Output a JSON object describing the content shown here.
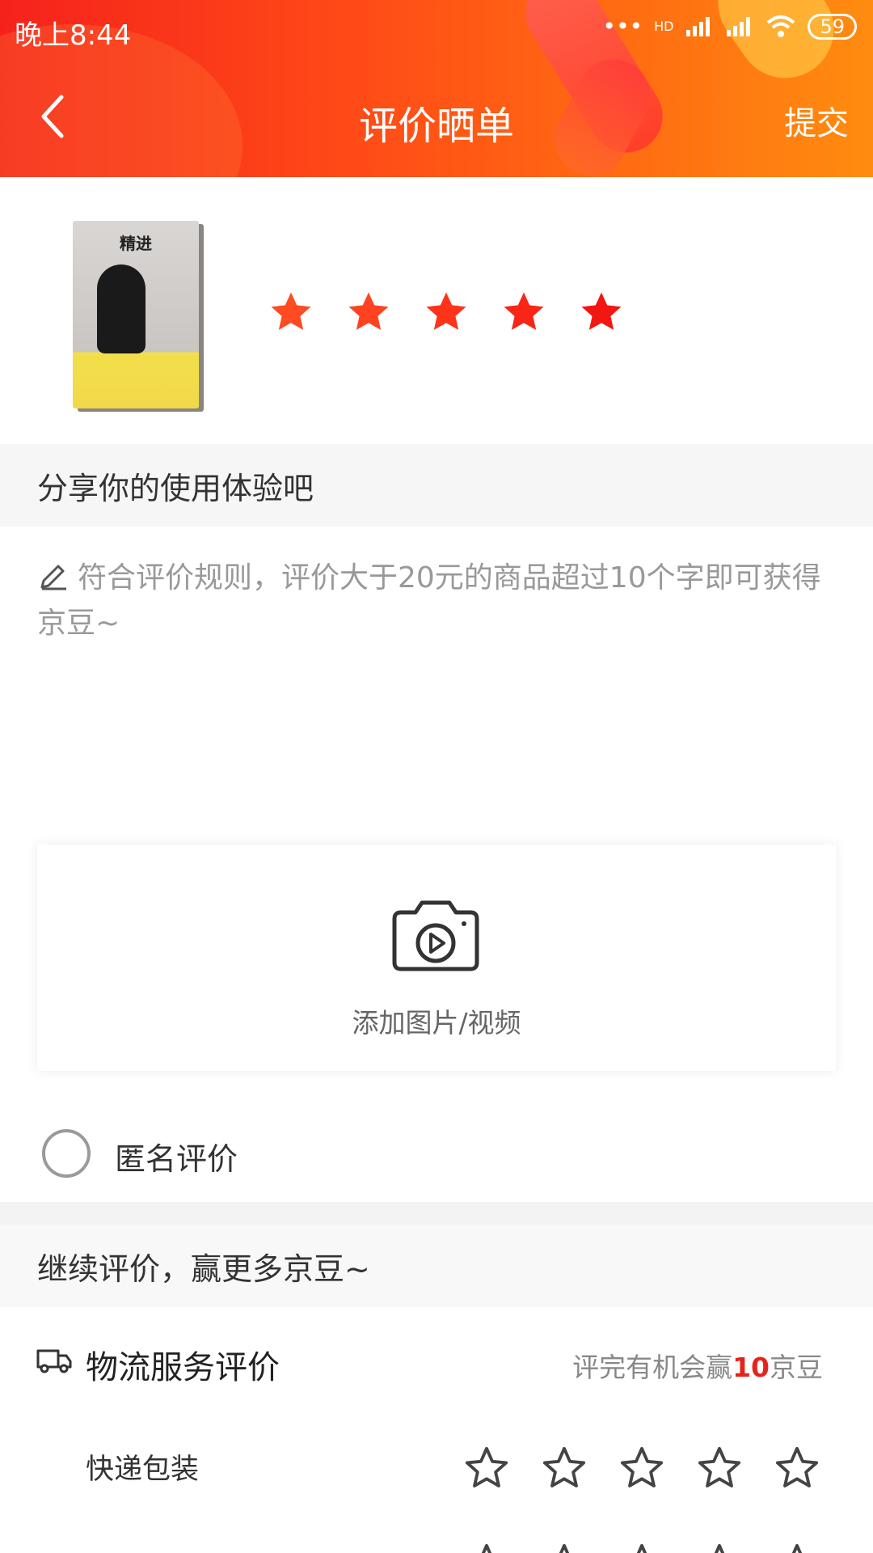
{
  "status_bar": {
    "time": "晚上8:44",
    "battery": "59",
    "network": "HD"
  },
  "header": {
    "title": "评价晒单",
    "submit": "提交"
  },
  "product": {
    "cover_title": "精进",
    "rating": 5,
    "star_color": "#ff3b1f"
  },
  "review": {
    "section_title": "分享你的使用体验吧",
    "placeholder": "符合评价规则，评价大于20元的商品超过10个字即可获得京豆~",
    "upload_label": "添加图片/视频",
    "anonymous_label": "匿名评价"
  },
  "more_reviews": {
    "section_title": "继续评价，赢更多京豆~"
  },
  "logistics": {
    "title": "物流服务评价",
    "reward_prefix": "评完有机会赢",
    "reward_num": "10",
    "reward_suffix": "京豆",
    "items": [
      {
        "label": "快递包装",
        "rating": 0
      }
    ]
  },
  "colors": {
    "accent": "#e4251c",
    "header_start": "#f5221c",
    "header_end": "#ff8c10"
  }
}
